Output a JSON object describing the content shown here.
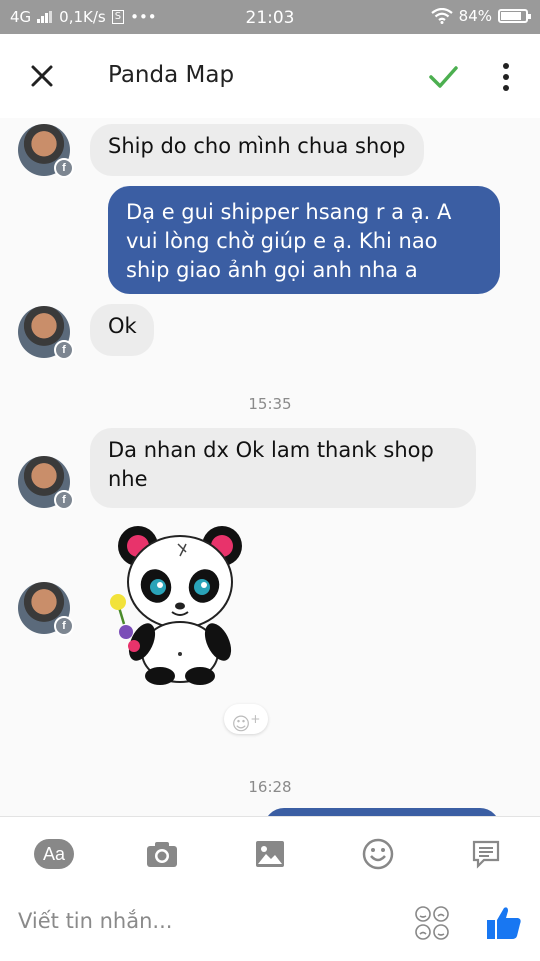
{
  "status_bar": {
    "network": "4G",
    "speed": "0,1K/s",
    "sim_badge": "S",
    "more": "•••",
    "time": "21:03",
    "battery": "84%",
    "battery_level": 0.84
  },
  "header": {
    "title": "Panda Map",
    "close_icon": "close-icon",
    "check_icon": "check-icon",
    "more_icon": "more-vertical-icon",
    "check_color": "#4caf50"
  },
  "messages": [
    {
      "from": "them",
      "text": "Ship do cho mình chua shop"
    },
    {
      "from": "me",
      "text": "Dạ e gui shipper hsang r a ạ. A vui lòng chờ giúp e ạ. Khi nao ship giao ảnh gọi anh nha a"
    },
    {
      "from": "them",
      "text": "Ok"
    },
    {
      "type": "timestamp",
      "text": "15:35"
    },
    {
      "from": "them",
      "text": "Da nhan dx Ok lam thank shop nhe"
    },
    {
      "from": "them",
      "type": "sticker",
      "sticker": "panda-sticker"
    },
    {
      "type": "timestamp",
      "text": "16:28"
    }
  ],
  "composer": {
    "placeholder": "Viết tin nhắn...",
    "aa_label": "Aa",
    "tools": [
      "text-format-icon",
      "camera-icon",
      "image-icon",
      "emoji-icon",
      "chat-bubble-icon"
    ],
    "like_color": "#1877f2"
  },
  "colors": {
    "status_bar": "#9a9a9a",
    "outgoing_bubble": "#3b5ea3",
    "incoming_bubble": "#ececec"
  }
}
